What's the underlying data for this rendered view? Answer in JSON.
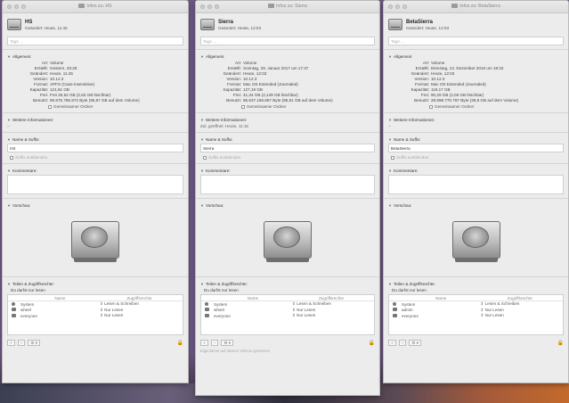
{
  "windows": [
    {
      "window_title": "Infos zu: HS",
      "name": "HS",
      "modified": "Geändert: Heute, 11:45",
      "tags_placeholder": "Tags …",
      "sections": {
        "general": "Allgemein:",
        "more_info": "Weitere Informationen:",
        "name_ext": "Name & Suffix:",
        "comments": "Kommentare:",
        "preview": "Vorschau:",
        "sharing": "Teilen & Zugriffsrechte:"
      },
      "general": [
        {
          "k": "Art:",
          "v": "Volume"
        },
        {
          "k": "Erstellt:",
          "v": "Gestern, 20:28"
        },
        {
          "k": "Geändert:",
          "v": "Heute, 11:45"
        },
        {
          "k": "Version:",
          "v": "10.12.3"
        },
        {
          "k": "Format:",
          "v": "APFS (Case-insensitive)"
        },
        {
          "k": "Kapazität:",
          "v": "121,81 GB"
        },
        {
          "k": "Frei:",
          "v": "Frei 26,52 GB (2,63 GB löschbar)"
        },
        {
          "k": "Benutzt:",
          "v": "95.875.785.972 Byte (95,87 GB auf dem Volume)"
        }
      ],
      "shared_label": "Gemeinsamer Ordner",
      "more_info_value": "--",
      "name_value": "HS",
      "hide_ext_label": "Suffix ausblenden",
      "perm_note": "Du darfst nur lesen",
      "perm_headers": [
        "Name",
        "Zugriffsrechte"
      ],
      "perm_rows": [
        {
          "name": "System",
          "priv": "Lesen & Schreiben",
          "icon": "user-icon"
        },
        {
          "name": "wheel",
          "priv": "Nur Lesen",
          "icon": "group-icon"
        },
        {
          "name": "everyone",
          "priv": "Nur Lesen",
          "icon": "group-icon"
        }
      ],
      "footnote": ""
    },
    {
      "window_title": "Infos zu: Sierra",
      "name": "Sierra",
      "modified": "Geändert: Heute, 12:03",
      "tags_placeholder": "Tags …",
      "sections": {
        "general": "Allgemein:",
        "more_info": "Weitere Informationen:",
        "name_ext": "Name & Suffix:",
        "comments": "Kommentare:",
        "preview": "Vorschau:",
        "sharing": "Teilen & Zugriffsrechte:"
      },
      "general": [
        {
          "k": "Art:",
          "v": "Volume"
        },
        {
          "k": "Erstellt:",
          "v": "Sonntag, 29. Januar 2017 um 17:47"
        },
        {
          "k": "Geändert:",
          "v": "Heute, 12:03"
        },
        {
          "k": "Version:",
          "v": "10.12.3"
        },
        {
          "k": "Format:",
          "v": "Mac OS Extended (Journaled)"
        },
        {
          "k": "Kapazität:",
          "v": "127,19 GB"
        },
        {
          "k": "Frei:",
          "v": "41,34 GB (2,149 GB löschbar)"
        },
        {
          "k": "Benutzt:",
          "v": "85.637.158.857 Byte (85,61 GB auf dem Volume)"
        }
      ],
      "shared_label": "Gemeinsamer Ordner",
      "more_info_value": "Zul. geöffnet: Heute, 11:15",
      "name_value": "Sierra",
      "hide_ext_label": "Suffix ausblenden",
      "perm_note": "Du darfst nur lesen",
      "perm_headers": [
        "Name",
        "Zugriffsrechte"
      ],
      "perm_rows": [
        {
          "name": "System",
          "priv": "Lesen & Schreiben",
          "icon": "user-icon"
        },
        {
          "name": "wheel",
          "priv": "Nur Lesen",
          "icon": "group-icon"
        },
        {
          "name": "everyone",
          "priv": "Nur Lesen",
          "icon": "group-icon"
        }
      ],
      "footnote": "Eigentümer auf diesem Volume ignorieren"
    },
    {
      "window_title": "Infos zu: BetaSierra",
      "name": "BetaSierra",
      "modified": "Geändert: Heute, 12:03",
      "tags_placeholder": "Tags …",
      "sections": {
        "general": "Allgemein:",
        "more_info": "Weitere Informationen:",
        "name_ext": "Name & Suffix:",
        "comments": "Kommentare:",
        "preview": "Vorschau:",
        "sharing": "Teilen & Zugriffsrechte:"
      },
      "general": [
        {
          "k": "Art:",
          "v": "Volume"
        },
        {
          "k": "Erstellt:",
          "v": "Dienstag, 13. Dezember 2016 um 18:22"
        },
        {
          "k": "Geändert:",
          "v": "Heute, 12:03"
        },
        {
          "k": "Version:",
          "v": "10.12.3"
        },
        {
          "k": "Format:",
          "v": "Mac OS Extended (Journaled)"
        },
        {
          "k": "Kapazität:",
          "v": "119,17 GB"
        },
        {
          "k": "Frei:",
          "v": "90,29 GB (2,05 GB löschbar)"
        },
        {
          "k": "Benutzt:",
          "v": "28.898.770.787 Byte (28,9 GB auf dem Volume)"
        }
      ],
      "shared_label": "Gemeinsamer Ordner",
      "more_info_value": "--",
      "name_value": "BetaSierra",
      "hide_ext_label": "Suffix ausblenden",
      "perm_note": "Du darfst nur lesen",
      "perm_headers": [
        "Name",
        "Zugriffsrechte"
      ],
      "perm_rows": [
        {
          "name": "System",
          "priv": "Lesen & Schreiben",
          "icon": "user-icon"
        },
        {
          "name": "admin",
          "priv": "Nur Lesen",
          "icon": "group-icon"
        },
        {
          "name": "everyone",
          "priv": "Nur Lesen",
          "icon": "group-icon"
        }
      ],
      "footnote": ""
    }
  ],
  "toolbar": {
    "add_label": "+",
    "remove_label": "−",
    "action_label": "⚙ ▾",
    "lock_icon": "lock-icon"
  },
  "colors": {
    "desktop": "#6d5a86",
    "lock": "#d8921c"
  }
}
